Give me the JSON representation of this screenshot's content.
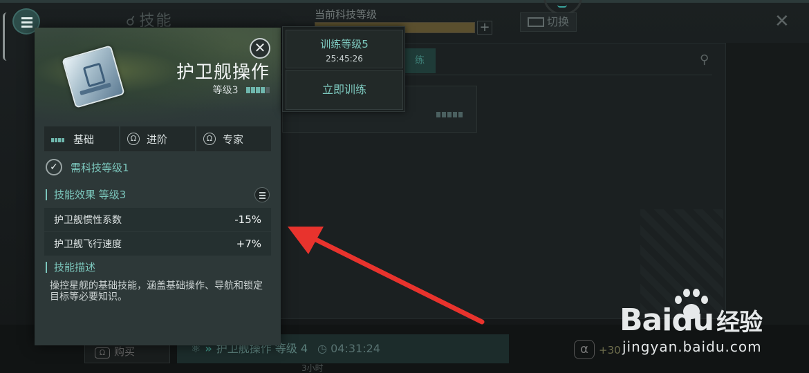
{
  "background": {
    "header_title": "技能",
    "level_label": "当前科技等级",
    "level_progress": 1.0,
    "plus_label": "+",
    "switch_label": "切换",
    "buy_label": "购买",
    "queue": {
      "skill": "护卫舰操作 等级 4",
      "time": "04:31:24",
      "duration": "3小时"
    },
    "alpha_label": "+30",
    "alpha_icon": "α"
  },
  "skill": {
    "name": "护卫舰操作",
    "level_text": "等级3",
    "level_value": 3,
    "level_max": 5,
    "tabs": [
      {
        "label": "基础",
        "icon": "level-pips-icon"
      },
      {
        "label": "进阶",
        "icon": "omega-icon"
      },
      {
        "label": "专家",
        "icon": "omega-icon"
      }
    ],
    "requirement": "需科技等级1",
    "effects_title": "技能效果 等级3",
    "effects": [
      {
        "name": "护卫舰惯性系数",
        "value": "-15%"
      },
      {
        "name": "护卫舰飞行速度",
        "value": "+7%"
      }
    ],
    "desc_title": "技能描述",
    "description": "操控星舰的基础技能，涵盖基础操作、导航和锁定目标等必要知识。"
  },
  "training": {
    "level_label": "训练等级5",
    "time": "25:45:26",
    "train_now_label": "立即训练"
  },
  "watermark": {
    "logo_text": "Bai",
    "logo_du": "du",
    "logo_cn": "经验",
    "url": "jingyan.baidu.com"
  },
  "colors": {
    "accent": "#7cc7bd",
    "arrow": "#e8332d"
  }
}
